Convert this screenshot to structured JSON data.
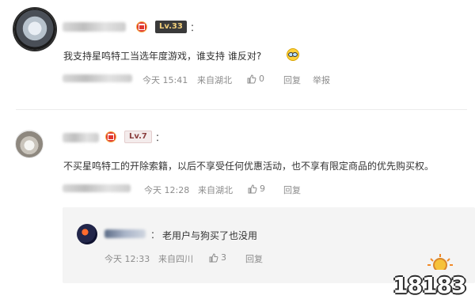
{
  "comments": [
    {
      "level": "Lv.33",
      "text": "我支持星鸣特工当选年度游戏，谁支持 谁反对?",
      "emoji": "glasses-emoji",
      "time": "今天 15:41",
      "location": "来自湖北",
      "likes": "0",
      "reply_label": "回复",
      "report_label": "举报"
    },
    {
      "level": "Lv.7",
      "text": "不买星鸣特工的开除索籍，以后不享受任何优惠活动，也不享有限定商品的优先购买权。",
      "time": "今天 12:28",
      "location": "来自湖北",
      "likes": "9",
      "reply_label": "回复"
    }
  ],
  "reply": {
    "text": "老用户与狗买了也没用",
    "time": "今天 12:33",
    "location": "来自四川",
    "likes": "3",
    "reply_label": "回复"
  },
  "colon": "：",
  "watermark": "18183"
}
